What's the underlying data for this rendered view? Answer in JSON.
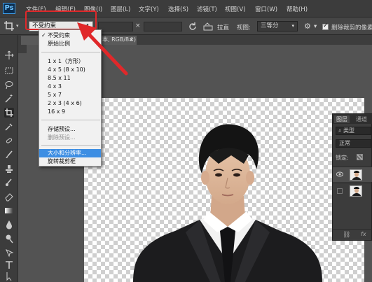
{
  "app": {
    "logo": "Ps"
  },
  "menu": [
    "文件(F)",
    "编辑(E)",
    "图像(I)",
    "图层(L)",
    "文字(Y)",
    "选择(S)",
    "滤镜(T)",
    "视图(V)",
    "窗口(W)",
    "帮助(H)"
  ],
  "options_bar": {
    "ratio_value": "不受约束",
    "straighten_label": "拉直",
    "view_label": "视图:",
    "view_value": "三等分",
    "delete_cropped_label": "删除裁剪的像素",
    "delete_cropped_checked": true
  },
  "document_tab": {
    "title": "本, RGB/8#) *",
    "partial_prefix": "11",
    "close": "×"
  },
  "dropdown": {
    "groups": [
      [
        {
          "label": "不受约束",
          "checked": true
        },
        {
          "label": "原始比例"
        }
      ],
      [
        {
          "label": "1 x 1（方形）"
        },
        {
          "label": "4 x 5 (8 x 10)"
        },
        {
          "label": "8.5 x 11"
        },
        {
          "label": "4 x 3"
        },
        {
          "label": "5 x 7"
        },
        {
          "label": "2 x 3 (4 x 6)"
        },
        {
          "label": "16 x 9"
        }
      ],
      [
        {
          "label": "存储预设..."
        },
        {
          "label": "删除预设...",
          "disabled": true
        }
      ],
      [
        {
          "label": "大小和分辨率...",
          "highlighted": true
        },
        {
          "label": "旋转裁剪框"
        }
      ]
    ]
  },
  "layers_panel": {
    "tabs": [
      "图层",
      "通道"
    ],
    "search_label": "类型",
    "blend_mode": "正常",
    "lock_label": "锁定:",
    "icons": [
      "search-icon",
      "eye-icon",
      "link-icon",
      "fx-icon",
      "lock-icon"
    ]
  },
  "colors": {
    "annotation_red": "#e0282a",
    "highlight_blue": "#3d8ee3",
    "ui_dark": "#3c3c3c"
  }
}
